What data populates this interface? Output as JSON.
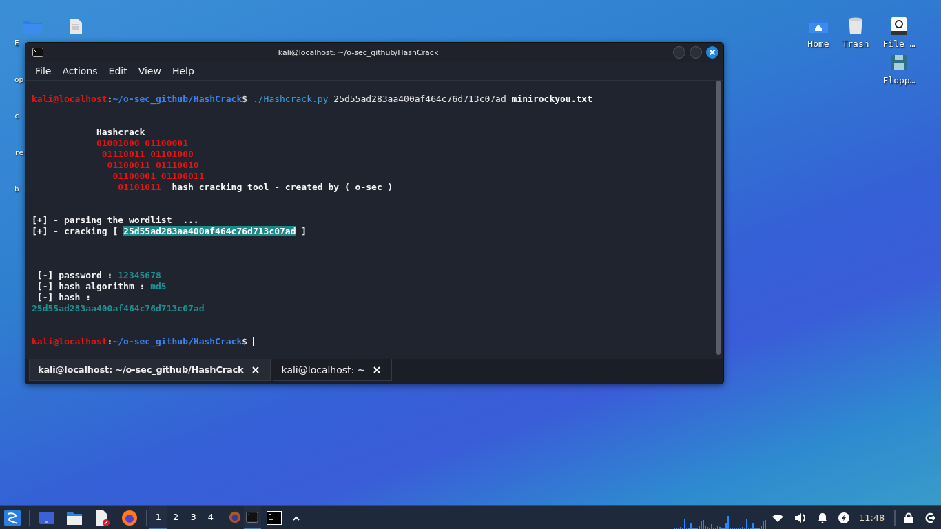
{
  "desktop_icons_left": [
    {
      "label": "E"
    },
    {
      "label": "op"
    },
    {
      "label": "c"
    },
    {
      "label": "re"
    },
    {
      "label": "b"
    }
  ],
  "desktop_icons_right": [
    {
      "label": "Home"
    },
    {
      "label": "Trash"
    },
    {
      "label": "File …"
    },
    {
      "label": "Flopp…"
    }
  ],
  "window": {
    "title": "kali@localhost: ~/o-sec_github/HashCrack",
    "menu": [
      "File",
      "Actions",
      "Edit",
      "View",
      "Help"
    ],
    "lines": [
      {
        "kind": "text",
        "segments": [
          {
            "kind": "user",
            "text": "kali@localhost"
          },
          {
            "kind": "plain",
            "text": ":"
          },
          {
            "kind": "path",
            "text": "~/o-sec_github/HashCrack"
          },
          {
            "kind": "plain",
            "text": "$ "
          },
          {
            "kind": "command",
            "text": "./Hashcrack.py"
          },
          {
            "kind": "normal",
            "text": " 25d55ad283aa400af464c76d713c07ad "
          },
          {
            "kind": "bold",
            "text": "minirockyou.txt"
          }
        ]
      },
      {
        "kind": "blank"
      },
      {
        "kind": "blank"
      },
      {
        "kind": "text",
        "segments": [
          {
            "kind": "bold",
            "text": "            Hashcrack"
          }
        ]
      },
      {
        "kind": "text",
        "segments": [
          {
            "kind": "red",
            "text": "            01001000 01100001"
          }
        ]
      },
      {
        "kind": "text",
        "segments": [
          {
            "kind": "red",
            "text": "             01110011 01101000"
          }
        ]
      },
      {
        "kind": "text",
        "segments": [
          {
            "kind": "red",
            "text": "              01100011 01110010"
          }
        ]
      },
      {
        "kind": "text",
        "segments": [
          {
            "kind": "red",
            "text": "               01100001 01100011"
          }
        ]
      },
      {
        "kind": "text",
        "segments": [
          {
            "kind": "red",
            "text": "                01101011"
          },
          {
            "kind": "bold",
            "text": "  hash cracking tool - created by ( o-sec )"
          }
        ]
      },
      {
        "kind": "blank"
      },
      {
        "kind": "blank"
      },
      {
        "kind": "text",
        "segments": [
          {
            "kind": "bold",
            "text": "[+] - parsing the wordlist  ..."
          }
        ]
      },
      {
        "kind": "text",
        "segments": [
          {
            "kind": "bold",
            "text": "[+] - cracking [ "
          },
          {
            "kind": "highlight",
            "text": "25d55ad283aa400af464c76d713c07ad"
          },
          {
            "kind": "bold",
            "text": " ]"
          }
        ]
      },
      {
        "kind": "blank"
      },
      {
        "kind": "blank"
      },
      {
        "kind": "blank"
      },
      {
        "kind": "text",
        "segments": [
          {
            "kind": "bold",
            "text": " [-] password : "
          },
          {
            "kind": "value",
            "text": "12345678"
          }
        ]
      },
      {
        "kind": "text",
        "segments": [
          {
            "kind": "bold",
            "text": " [-] hash algorithm : "
          },
          {
            "kind": "value",
            "text": "md5"
          }
        ]
      },
      {
        "kind": "text",
        "segments": [
          {
            "kind": "bold",
            "text": " [-] hash :"
          }
        ]
      },
      {
        "kind": "text",
        "segments": [
          {
            "kind": "value",
            "text": "25d55ad283aa400af464c76d713c07ad"
          }
        ]
      },
      {
        "kind": "blank"
      },
      {
        "kind": "blank"
      },
      {
        "kind": "text",
        "cursor": true,
        "segments": [
          {
            "kind": "user",
            "text": "kali@localhost"
          },
          {
            "kind": "plain",
            "text": ":"
          },
          {
            "kind": "path",
            "text": "~/o-sec_github/HashCrack"
          },
          {
            "kind": "plain",
            "text": "$ "
          }
        ]
      }
    ],
    "tabs": [
      {
        "label": "kali@localhost: ~/o-sec_github/HashCrack",
        "selected": true
      },
      {
        "label": "kali@localhost: ~",
        "selected": false
      }
    ]
  },
  "taskbar": {
    "workspaces": [
      {
        "label": "1",
        "selected": true
      },
      {
        "label": "2",
        "selected": false
      },
      {
        "label": "3",
        "selected": false
      },
      {
        "label": "4",
        "selected": false
      }
    ],
    "tasks": [
      {
        "selected": false
      },
      {
        "selected": true
      }
    ],
    "clock": "11:48"
  }
}
